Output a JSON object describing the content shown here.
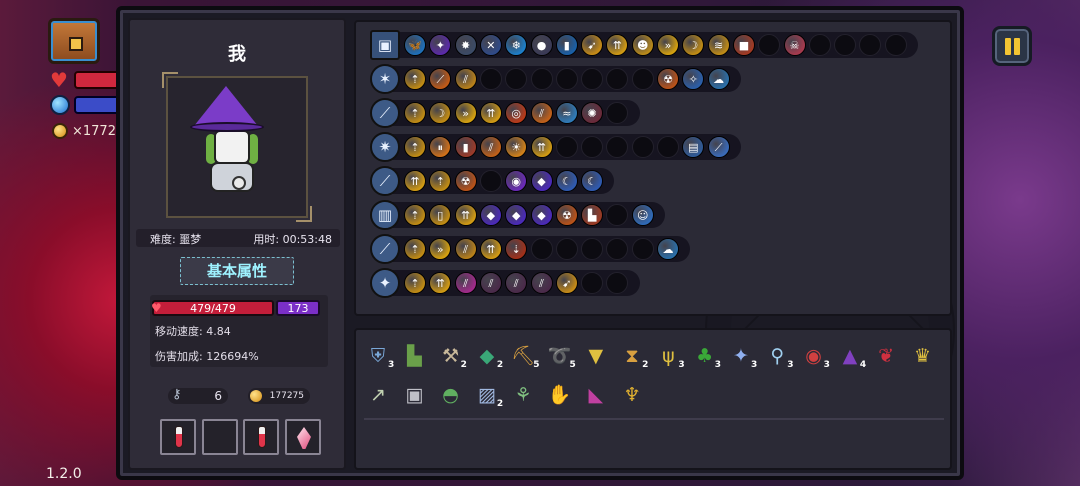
{
  "hud": {
    "gold_text": "×1772",
    "version": "1.2.0"
  },
  "character": {
    "name": "我",
    "difficulty_label": "难度: 噩梦",
    "time_label": "用时: 00:53:48",
    "attributes_button": "基本属性",
    "hp": "479/479",
    "shield": "173",
    "move_speed": "移动速度: 4.84",
    "damage_bonus": "伤害加成: 126694%",
    "keys": "6",
    "gold": "177275"
  },
  "skill_rows": [
    {
      "weapon_icon": "chest-icon",
      "icons": [
        {
          "icon": "butterfly",
          "color": "#1f6fb8",
          "glyph": "🦋"
        },
        {
          "icon": "purple-flame",
          "color": "#5a2aa8",
          "glyph": "✦"
        },
        {
          "icon": "white-star",
          "color": "#3b4a66",
          "glyph": "✸"
        },
        {
          "icon": "crossed-blades",
          "color": "#2f4a88",
          "glyph": "✕"
        },
        {
          "icon": "ice-shard",
          "color": "#1d7ec9",
          "glyph": "❄"
        },
        {
          "icon": "dark-orb",
          "color": "#3a3a56",
          "glyph": "●"
        },
        {
          "icon": "potion",
          "color": "#1a5fa6",
          "glyph": "▮"
        },
        {
          "icon": "gold-arrow-burst",
          "color": "#c58a17",
          "glyph": "➹"
        },
        {
          "icon": "gold-up-arrows",
          "color": "#d19a14",
          "glyph": "⇈"
        },
        {
          "icon": "gold-mask",
          "color": "#ba8a1a",
          "glyph": "☻"
        },
        {
          "icon": "double-chevron",
          "color": "#d4a010",
          "glyph": "»"
        },
        {
          "icon": "green-crescent",
          "color": "#c08b14",
          "glyph": "☽"
        },
        {
          "icon": "gold-wind",
          "color": "#bf8b17",
          "glyph": "≋"
        },
        {
          "icon": "red-book",
          "color": "#a23a24",
          "glyph": "■"
        },
        {
          "icon": "empty"
        },
        {
          "icon": "pink-mask",
          "color": "#a63a4e",
          "glyph": "☠"
        },
        {
          "icon": "empty"
        },
        {
          "icon": "empty"
        },
        {
          "icon": "empty"
        },
        {
          "icon": "empty"
        }
      ]
    },
    {
      "weapon_icon": "crystal-staff-icon",
      "icons": [
        {
          "icon": "stat-up",
          "color": "#c08b14",
          "glyph": "⇡"
        },
        {
          "icon": "orange-slash",
          "color": "#c05a17",
          "glyph": "⟋"
        },
        {
          "icon": "gold-claw",
          "color": "#b8801a",
          "glyph": "⫽"
        },
        {
          "icon": "empty"
        },
        {
          "icon": "empty"
        },
        {
          "icon": "empty"
        },
        {
          "icon": "empty"
        },
        {
          "icon": "empty"
        },
        {
          "icon": "empty"
        },
        {
          "icon": "empty"
        },
        {
          "icon": "radiation",
          "color": "#b8521a",
          "glyph": "☢"
        },
        {
          "icon": "blue-sparkle",
          "color": "#2b5ea8",
          "glyph": "✧"
        },
        {
          "icon": "ghost-swirl",
          "color": "#2b6fa8",
          "glyph": "☁"
        }
      ]
    },
    {
      "weapon_icon": "rainbow-wand-icon",
      "icons": [
        {
          "icon": "stat-up",
          "color": "#c08b14",
          "glyph": "⇡"
        },
        {
          "icon": "green-crescent",
          "color": "#c08b14",
          "glyph": "☽"
        },
        {
          "icon": "double-chevron",
          "color": "#d4a010",
          "glyph": "»"
        },
        {
          "icon": "gold-up-arrows",
          "color": "#d19a14",
          "glyph": "⇈"
        },
        {
          "icon": "red-target",
          "color": "#b83a1a",
          "glyph": "◎"
        },
        {
          "icon": "orange-claw",
          "color": "#c0601a",
          "glyph": "⫽"
        },
        {
          "icon": "rainbow-ray",
          "color": "#2f7ab8",
          "glyph": "≈"
        },
        {
          "icon": "red-gear",
          "color": "#6a2a3a",
          "glyph": "✺"
        },
        {
          "icon": "empty"
        }
      ]
    },
    {
      "weapon_icon": "star-staff-icon",
      "icons": [
        {
          "icon": "stat-up",
          "color": "#c08b14",
          "glyph": "⇡"
        },
        {
          "icon": "pause-orb",
          "color": "#d0701a",
          "glyph": "⏸"
        },
        {
          "icon": "red-jar",
          "color": "#9a3a2a",
          "glyph": "▮"
        },
        {
          "icon": "fire-claw",
          "color": "#c0601a",
          "glyph": "⫽"
        },
        {
          "icon": "sun-burst",
          "color": "#d0801a",
          "glyph": "☀"
        },
        {
          "icon": "gold-up-arrows",
          "color": "#d19a14",
          "glyph": "⇈"
        },
        {
          "icon": "empty"
        },
        {
          "icon": "empty"
        },
        {
          "icon": "empty"
        },
        {
          "icon": "empty"
        },
        {
          "icon": "empty"
        },
        {
          "icon": "spell-book",
          "color": "#2f5a98",
          "glyph": "▤"
        },
        {
          "icon": "blue-blade",
          "color": "#3a6ab8",
          "glyph": "⟋"
        }
      ]
    },
    {
      "weapon_icon": "fire-staff-icon",
      "icons": [
        {
          "icon": "gold-up-arrows",
          "color": "#d19a14",
          "glyph": "⇈"
        },
        {
          "icon": "stat-up",
          "color": "#c08b14",
          "glyph": "⇡"
        },
        {
          "icon": "radiation",
          "color": "#b8521a",
          "glyph": "☢"
        },
        {
          "icon": "empty"
        },
        {
          "icon": "purple-vortex",
          "color": "#6a2ab8",
          "glyph": "◉"
        },
        {
          "icon": "purple-diamond",
          "color": "#4a2ab8",
          "glyph": "◆"
        },
        {
          "icon": "blue-crescent",
          "color": "#2f5ab0",
          "glyph": "☾"
        },
        {
          "icon": "blue-crescent",
          "color": "#2f5ab0",
          "glyph": "☾"
        }
      ]
    },
    {
      "weapon_icon": "gauntlet-icon",
      "icons": [
        {
          "icon": "stat-up",
          "color": "#c08b14",
          "glyph": "⇡"
        },
        {
          "icon": "mouse-orb",
          "color": "#c08b14",
          "glyph": "▯"
        },
        {
          "icon": "gold-up-arrows",
          "color": "#d19a14",
          "glyph": "⇈"
        },
        {
          "icon": "purple-diamond",
          "color": "#4a2ab8",
          "glyph": "◆"
        },
        {
          "icon": "purple-diamond",
          "color": "#4a2ab8",
          "glyph": "◆"
        },
        {
          "icon": "purple-diamond",
          "color": "#4a2ab8",
          "glyph": "◆"
        },
        {
          "icon": "radiation",
          "color": "#b8521a",
          "glyph": "☢"
        },
        {
          "icon": "red-boot",
          "color": "#9a3a24",
          "glyph": "▙"
        },
        {
          "icon": "empty"
        },
        {
          "icon": "blue-ghost",
          "color": "#2f6ab8",
          "glyph": "☺"
        }
      ]
    },
    {
      "weapon_icon": "blue-sword-icon",
      "icons": [
        {
          "icon": "stat-up",
          "color": "#c08b14",
          "glyph": "⇡"
        },
        {
          "icon": "double-chevron",
          "color": "#d4a010",
          "glyph": "»"
        },
        {
          "icon": "gold-claw",
          "color": "#b8801a",
          "glyph": "⫽"
        },
        {
          "icon": "gold-up-arrows",
          "color": "#d19a14",
          "glyph": "⇈"
        },
        {
          "icon": "red-torch",
          "color": "#a0301a",
          "glyph": "⇣"
        },
        {
          "icon": "empty"
        },
        {
          "icon": "empty"
        },
        {
          "icon": "empty"
        },
        {
          "icon": "empty"
        },
        {
          "icon": "empty"
        },
        {
          "icon": "ghost-swirl",
          "color": "#2b6fa8",
          "glyph": "☁"
        }
      ]
    },
    {
      "weapon_icon": "shuriken-icon",
      "icons": [
        {
          "icon": "stat-up",
          "color": "#c08b14",
          "glyph": "⇡"
        },
        {
          "icon": "gold-up-arrows",
          "color": "#d19a14",
          "glyph": "⇈"
        },
        {
          "icon": "pink-claw",
          "color": "#a02a8a",
          "glyph": "⫽"
        },
        {
          "icon": "dark-claw",
          "color": "#4a2a4a",
          "glyph": "⫽"
        },
        {
          "icon": "dark-claw",
          "color": "#4a2a4a",
          "glyph": "⫽"
        },
        {
          "icon": "dark-claw",
          "color": "#4a2a4a",
          "glyph": "⫽"
        },
        {
          "icon": "gold-arrow-burst",
          "color": "#c58a17",
          "glyph": "➹"
        },
        {
          "icon": "empty"
        },
        {
          "icon": "empty"
        }
      ]
    }
  ],
  "items_row1": [
    {
      "icon": "blue-shield-icon",
      "glyph": "⛨",
      "color": "#7aa8d8",
      "count": "3"
    },
    {
      "icon": "green-boot-icon",
      "glyph": "▙",
      "color": "#6aa04a",
      "count": ""
    },
    {
      "icon": "bone-icon",
      "glyph": "⚒",
      "color": "#c8b89a",
      "count": "2"
    },
    {
      "icon": "green-gem-icon",
      "glyph": "◆",
      "color": "#3aa878",
      "count": "2"
    },
    {
      "icon": "pickaxe-icon",
      "glyph": "⛏",
      "color": "#d8a040",
      "count": "5"
    },
    {
      "icon": "lasso-icon",
      "glyph": "➰",
      "color": "#6ab8e0",
      "count": "5"
    },
    {
      "icon": "potion-flask-icon",
      "glyph": "▼",
      "color": "#e0c040",
      "count": ""
    },
    {
      "icon": "hourglass-icon",
      "glyph": "⧗",
      "color": "#d8a040",
      "count": "2"
    },
    {
      "icon": "antler-icon",
      "glyph": "ψ",
      "color": "#e0c040",
      "count": "3"
    },
    {
      "icon": "clover-icon",
      "glyph": "♣",
      "color": "#3aa838",
      "count": "3"
    },
    {
      "icon": "crystal-cluster-icon",
      "glyph": "✦",
      "color": "#90b0f0",
      "count": "3"
    },
    {
      "icon": "magnifier-icon",
      "glyph": "⚲",
      "color": "#a0d0f0",
      "count": "3"
    },
    {
      "icon": "eye-icon",
      "glyph": "◉",
      "color": "#d04040",
      "count": "3"
    },
    {
      "icon": "wizard-hat-icon",
      "glyph": "▲",
      "color": "#8040c0",
      "count": "4"
    },
    {
      "icon": "red-ribbon-icon",
      "glyph": "❦",
      "color": "#d03040",
      "count": ""
    },
    {
      "icon": "gold-jaw-icon",
      "glyph": "♛",
      "color": "#e0c040",
      "count": ""
    }
  ],
  "items_row2": [
    {
      "icon": "spear-icon",
      "glyph": "↗",
      "color": "#c0d0b0",
      "count": ""
    },
    {
      "icon": "armor-icon",
      "glyph": "▣",
      "color": "#c0c0c8",
      "count": ""
    },
    {
      "icon": "ufo-icon",
      "glyph": "◓",
      "color": "#60b060",
      "count": ""
    },
    {
      "icon": "scroll-stack-icon",
      "glyph": "▨",
      "color": "#a0b8e0",
      "count": "2"
    },
    {
      "icon": "feather-icon",
      "glyph": "⚘",
      "color": "#80c080",
      "count": ""
    },
    {
      "icon": "golden-gauntlet-icon",
      "glyph": "✋",
      "color": "#e0b030",
      "count": ""
    },
    {
      "icon": "rainbow-cape-icon",
      "glyph": "◣",
      "color": "#c040a0",
      "count": ""
    },
    {
      "icon": "golden-chalice-icon",
      "glyph": "♆",
      "color": "#e0b030",
      "count": ""
    }
  ]
}
